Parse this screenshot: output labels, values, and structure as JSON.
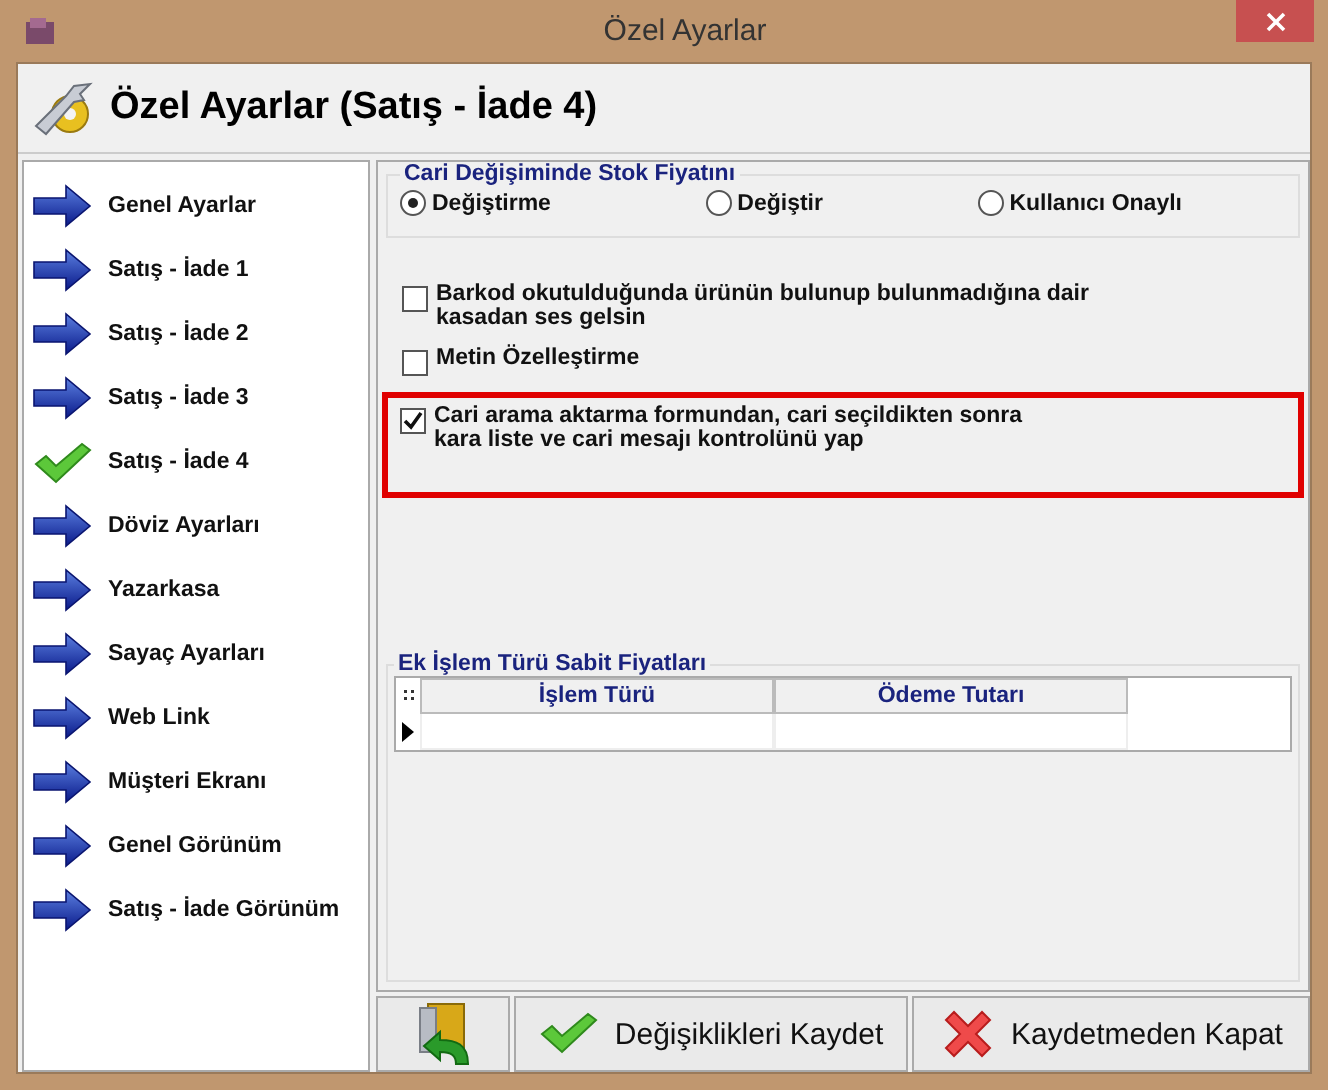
{
  "window": {
    "title": "Özel Ayarlar"
  },
  "header": {
    "title": "Özel Ayarlar (Satış - İade 4)"
  },
  "sidebar": {
    "items": [
      {
        "label": "Genel Ayarlar",
        "selected": false
      },
      {
        "label": "Satış - İade 1",
        "selected": false
      },
      {
        "label": "Satış - İade 2",
        "selected": false
      },
      {
        "label": "Satış - İade 3",
        "selected": false
      },
      {
        "label": "Satış - İade 4",
        "selected": true
      },
      {
        "label": "Döviz Ayarları",
        "selected": false
      },
      {
        "label": "Yazarkasa",
        "selected": false
      },
      {
        "label": "Sayaç Ayarları",
        "selected": false
      },
      {
        "label": "Web Link",
        "selected": false
      },
      {
        "label": "Müşteri Ekranı",
        "selected": false
      },
      {
        "label": "Genel Görünüm",
        "selected": false
      },
      {
        "label": "Satış - İade Görünüm",
        "selected": false
      }
    ]
  },
  "stock_price_group": {
    "title": "Cari Değişiminde Stok Fiyatını",
    "options": [
      {
        "label": "Değiştirme",
        "selected": true
      },
      {
        "label": "Değiştir",
        "selected": false
      },
      {
        "label": "Kullanıcı Onaylı",
        "selected": false
      }
    ]
  },
  "checkboxes": [
    {
      "label": "Barkod okutulduğunda ürünün bulunup bulunmadığına dair kasadan ses gelsin",
      "checked": false,
      "highlighted": false
    },
    {
      "label": "Metin Özelleştirme",
      "checked": false,
      "highlighted": false
    },
    {
      "label": "Cari arama aktarma formundan, cari seçildikten sonra kara liste ve cari mesajı kontrolünü yap",
      "checked": true,
      "highlighted": true
    }
  ],
  "fixed_prices": {
    "title": "Ek İşlem Türü Sabit Fiyatları",
    "columns": [
      "İşlem Türü",
      "Ödeme Tutarı"
    ]
  },
  "buttons": [
    {
      "kind": "exit"
    },
    {
      "kind": "save",
      "label": "Değişiklikleri Kaydet"
    },
    {
      "kind": "cancel",
      "label": "Kaydetmeden Kapat"
    }
  ]
}
